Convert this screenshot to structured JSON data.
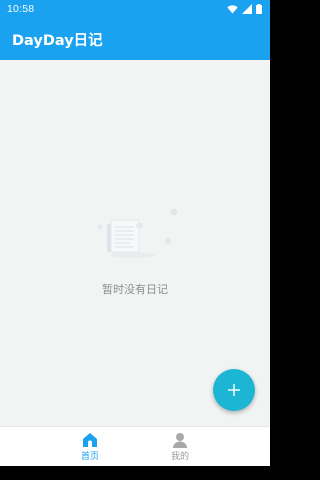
{
  "status_bar": {
    "time": "10:58"
  },
  "app_bar": {
    "title": "DayDay日记"
  },
  "empty_state": {
    "message": "暂时没有日记"
  },
  "fab": {
    "icon": "plus-icon"
  },
  "bottom_nav": {
    "items": [
      {
        "label": "首页",
        "icon": "home-icon",
        "active": true
      },
      {
        "label": "我的",
        "icon": "person-icon",
        "active": false
      }
    ]
  },
  "colors": {
    "primary": "#1aa1f0",
    "fab": "#1cb6d4",
    "background": "#f2f3f3",
    "inactive": "#9a9a9a"
  }
}
